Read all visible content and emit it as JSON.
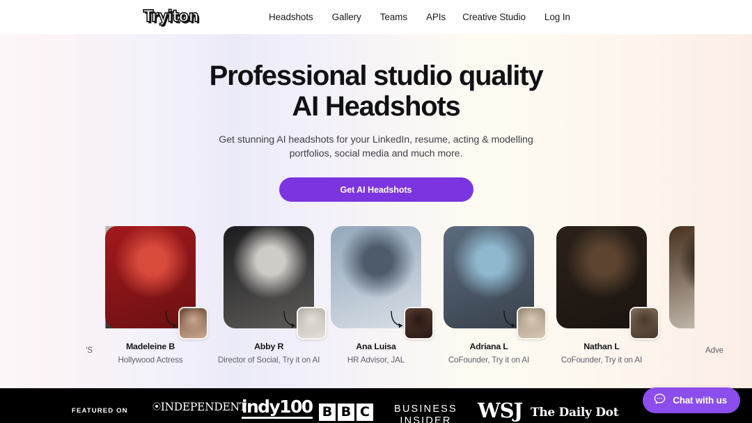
{
  "nav": {
    "logo_text": "Tryiton",
    "links": [
      {
        "label": "Headshots"
      },
      {
        "label": "Gallery"
      },
      {
        "label": "Teams"
      },
      {
        "label": "APIs"
      },
      {
        "label": "Creative Studio"
      },
      {
        "label": "Log In"
      }
    ]
  },
  "hero": {
    "title_line1": "Professional studio quality",
    "title_line2": "AI Headshots",
    "subtitle_line1": "Get stunning AI headshots for your LinkedIn, resume, acting & modelling",
    "subtitle_line2": "portfolios, social media and much more.",
    "cta_label": "Get AI Headshots",
    "cta_color": "#7c34e0"
  },
  "carousel": {
    "cards": [
      {
        "name": "",
        "role": "'S",
        "partial": "left",
        "photo_colors": [
          "#d8d4cf",
          "#8d8a86",
          "#2a2a2c"
        ],
        "thumb_colors": [
          "#3b78a8",
          "#1d2b38"
        ]
      },
      {
        "name": "Madeleine B",
        "role": "Hollywood Actress",
        "partial": "",
        "photo_colors": [
          "#a3191c",
          "#d84a3c",
          "#6b1012"
        ],
        "thumb_colors": [
          "#6d4a38",
          "#c9a88f"
        ]
      },
      {
        "name": "Abby R",
        "role": "Director of Social, Try it on AI",
        "partial": "",
        "photo_colors": [
          "#1c1c1e",
          "#cfcbc6",
          "#5e5c5a"
        ],
        "thumb_colors": [
          "#b9b2ab",
          "#e3ded8"
        ]
      },
      {
        "name": "Ana Luisa",
        "role": "HR Advisor, JAL",
        "partial": "",
        "photo_colors": [
          "#93a8bc",
          "#4d5b6b",
          "#d8dfe6"
        ],
        "thumb_colors": [
          "#5a3a30",
          "#2a1a16"
        ]
      },
      {
        "name": "Adriana L",
        "role": "CoFounder, Try it on AI",
        "partial": "",
        "photo_colors": [
          "#5b6b7d",
          "#8fb8cf",
          "#39424d"
        ],
        "thumb_colors": [
          "#9b8b76",
          "#d6c9b6"
        ]
      },
      {
        "name": "Nathan L",
        "role": "CoFounder, Try it on AI",
        "partial": "",
        "photo_colors": [
          "#2b2119",
          "#5c4430",
          "#1a1410"
        ],
        "thumb_colors": [
          "#7e6a56",
          "#4a3a2c"
        ]
      },
      {
        "name": "",
        "role": "Adve",
        "partial": "right",
        "photo_colors": [
          "#47301d",
          "#1a120c",
          "#d9d2c8"
        ],
        "thumb_colors": [
          "#3a2a1e",
          "#1a120c"
        ]
      }
    ]
  },
  "featured": {
    "label": "FEATURED ON",
    "independent": "INDEPENDENT",
    "indy100": "indy100",
    "bbc": [
      "B",
      "B",
      "C"
    ],
    "business_insider_line1": "BUSINESS",
    "business_insider_line2": "INSIDER",
    "wsj": "WSJ",
    "daily_dot": "The Daily Dot"
  },
  "chat": {
    "label": "Chat with us",
    "icon": "chat-bubble-icon",
    "color": "#8b4deb"
  }
}
